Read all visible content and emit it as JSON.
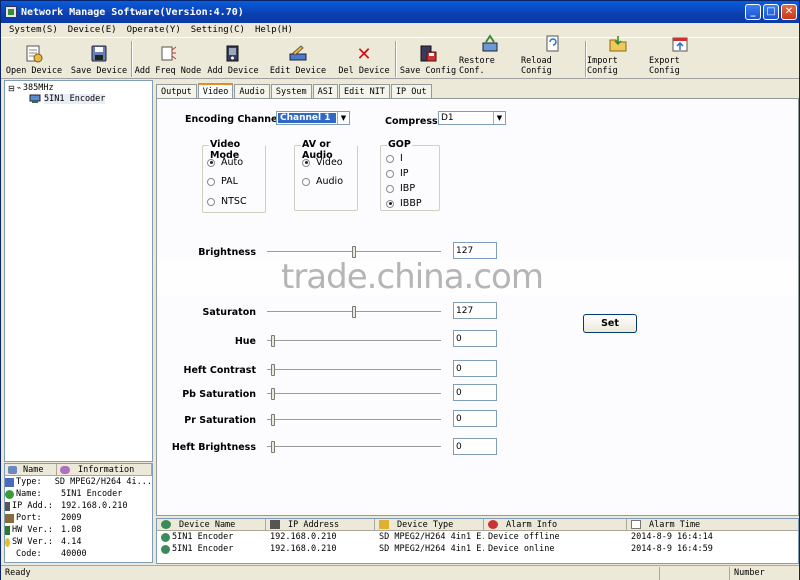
{
  "titlebar": {
    "title": "Network Manage Software(Version:4.70)",
    "minimize": "_",
    "maximize": "□",
    "close": "✕"
  },
  "menu": [
    "System(S)",
    "Device(E)",
    "Operate(Y)",
    "Setting(C)",
    "Help(H)"
  ],
  "toolbar": [
    {
      "label": "Open Device",
      "icon": "open-device-icon"
    },
    {
      "label": "Save Device",
      "icon": "save-device-icon"
    },
    {
      "label": "Add Freq Node",
      "icon": "add-freq-node-icon"
    },
    {
      "label": "Add Device",
      "icon": "add-device-icon"
    },
    {
      "label": "Edit Device",
      "icon": "edit-device-icon"
    },
    {
      "label": "Del Device",
      "icon": "delete-icon"
    },
    {
      "label": "Save Config",
      "icon": "save-config-icon"
    },
    {
      "label": "Restore Conf.",
      "icon": "restore-config-icon"
    },
    {
      "label": "Reload Config",
      "icon": "reload-config-icon"
    },
    {
      "label": "Import Config",
      "icon": "import-config-icon"
    },
    {
      "label": "Export Config",
      "icon": "export-config-icon"
    }
  ],
  "tree": {
    "root": "385MHz",
    "child": "5IN1  Encoder",
    "expander": "⊟"
  },
  "info": {
    "headers": [
      "Name",
      "Information"
    ],
    "rows": [
      {
        "k": "Type:",
        "v": "SD MPEG2/H264 4i..."
      },
      {
        "k": "Name:",
        "v": "5IN1  Encoder"
      },
      {
        "k": "IP Add.:",
        "v": "192.168.0.210"
      },
      {
        "k": "Port:",
        "v": "2009"
      },
      {
        "k": "HW Ver.:",
        "v": "1.08"
      },
      {
        "k": "SW Ver.:",
        "v": "4.14"
      },
      {
        "k": "Code:",
        "v": "40000"
      }
    ]
  },
  "tabs": [
    "Output",
    "Video",
    "Audio",
    "System",
    "ASI",
    "Edit NIT",
    "IP Out"
  ],
  "active_tab": "Video",
  "video": {
    "encoding_channel_label": "Encoding Channel:",
    "encoding_channel_value": "Channel 1",
    "compress_label": "Compress",
    "compress_value": "D1",
    "video_mode": {
      "title": "Video Mode",
      "options": [
        "Auto",
        "PAL",
        "NTSC"
      ],
      "selected": "Auto"
    },
    "av_audio": {
      "title": "AV or Audio",
      "options": [
        "Video",
        "Audio"
      ],
      "selected": "Video"
    },
    "gop": {
      "title": "GOP",
      "options": [
        "I",
        "IP",
        "IBP",
        "IBBP"
      ],
      "selected": "IBBP"
    },
    "sliders": [
      {
        "label": "Brightness",
        "value": "127",
        "level": 0.5
      },
      {
        "label": "Saturaton",
        "value": "127",
        "level": 0.5
      },
      {
        "label": "Hue",
        "value": "0",
        "level": 0
      },
      {
        "label": "Heft Contrast",
        "value": "0",
        "level": 0
      },
      {
        "label": "Pb Saturation",
        "value": "0",
        "level": 0
      },
      {
        "label": "Pr Saturation",
        "value": "0",
        "level": 0
      },
      {
        "label": "Heft Brightness",
        "value": "0",
        "level": 0
      }
    ],
    "set_label": "Set"
  },
  "watermark": "trade.china.com",
  "alarm": {
    "headers": [
      "Device Name",
      "IP Address",
      "Device Type",
      "Alarm Info",
      "Alarm Time"
    ],
    "rows": [
      [
        "5IN1  Encoder",
        "192.168.0.210",
        "SD MPEG2/H264 4in1 E...",
        "Device offline",
        "2014-8-9 16:4:14"
      ],
      [
        "5IN1  Encoder",
        "192.168.0.210",
        "SD MPEG2/H264 4in1 E...",
        "Device online",
        "2014-8-9 16:4:59"
      ]
    ]
  },
  "status": {
    "left": "Ready",
    "right": "Number"
  }
}
